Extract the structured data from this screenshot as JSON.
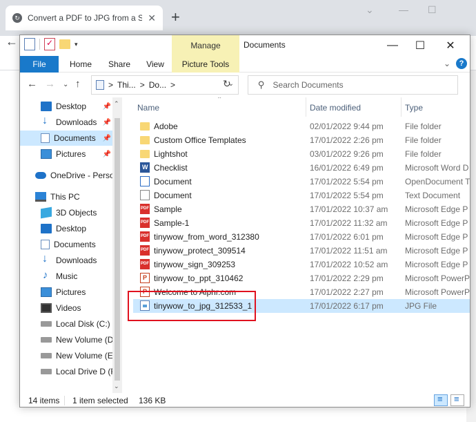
{
  "browser": {
    "tab_title": "Convert a PDF to JPG from a Sma",
    "tab_close": "✕",
    "new_tab": "+",
    "window_controls": [
      "⌄",
      "—",
      "☐"
    ]
  },
  "explorer": {
    "title": "Documents",
    "manage_label": "Manage",
    "ribbon_tabs": [
      "File",
      "Home",
      "Share",
      "View",
      "Picture Tools"
    ],
    "address_parts": [
      "Thi...",
      "Do..."
    ],
    "address_sep": ">",
    "search_placeholder": "Search Documents",
    "columns": {
      "name": "Name",
      "date": "Date modified",
      "type": "Type"
    },
    "quick_access": [
      {
        "label": "Desktop",
        "icon": "desktop-icon"
      },
      {
        "label": "Downloads",
        "icon": "downloads-icon"
      },
      {
        "label": "Documents",
        "icon": "documents-icon"
      },
      {
        "label": "Pictures",
        "icon": "pictures-icon"
      }
    ],
    "onedrive": "OneDrive - Person",
    "this_pc": "This PC",
    "pc_items": [
      {
        "label": "3D Objects",
        "icon": "3d-objects-icon"
      },
      {
        "label": "Desktop",
        "icon": "desktop-icon"
      },
      {
        "label": "Documents",
        "icon": "documents-icon"
      },
      {
        "label": "Downloads",
        "icon": "downloads-icon"
      },
      {
        "label": "Music",
        "icon": "music-icon"
      },
      {
        "label": "Pictures",
        "icon": "pictures-icon"
      },
      {
        "label": "Videos",
        "icon": "videos-icon"
      },
      {
        "label": "Local Disk (C:)",
        "icon": "drive-icon"
      },
      {
        "label": "New Volume (D:",
        "icon": "drive-icon"
      },
      {
        "label": "New Volume (E:)",
        "icon": "drive-icon"
      },
      {
        "label": "Local Drive D (F:",
        "icon": "drive-icon"
      }
    ],
    "files": [
      {
        "name": "Adobe",
        "date": "02/01/2022 9:44 pm",
        "type": "File folder",
        "icon": "folder"
      },
      {
        "name": "Custom Office Templates",
        "date": "17/01/2022 2:26 pm",
        "type": "File folder",
        "icon": "folder"
      },
      {
        "name": "Lightshot",
        "date": "03/01/2022 9:26 pm",
        "type": "File folder",
        "icon": "folder"
      },
      {
        "name": "Checklist",
        "date": "16/01/2022 6:49 pm",
        "type": "Microsoft Word D",
        "icon": "word"
      },
      {
        "name": "Document",
        "date": "17/01/2022 5:54 pm",
        "type": "OpenDocument T",
        "icon": "odt"
      },
      {
        "name": "Document",
        "date": "17/01/2022 5:54 pm",
        "type": "Text Document",
        "icon": "txt"
      },
      {
        "name": "Sample",
        "date": "17/01/2022 10:37 am",
        "type": "Microsoft Edge P",
        "icon": "pdf"
      },
      {
        "name": "Sample-1",
        "date": "17/01/2022 11:32 am",
        "type": "Microsoft Edge P",
        "icon": "pdf"
      },
      {
        "name": "tinywow_from_word_312380",
        "date": "17/01/2022 6:01 pm",
        "type": "Microsoft Edge P",
        "icon": "pdf"
      },
      {
        "name": "tinywow_protect_309514",
        "date": "17/01/2022 11:51 am",
        "type": "Microsoft Edge P",
        "icon": "pdf"
      },
      {
        "name": "tinywow_sign_309253",
        "date": "17/01/2022 10:52 am",
        "type": "Microsoft Edge P",
        "icon": "pdf"
      },
      {
        "name": "tinywow_to_ppt_310462",
        "date": "17/01/2022 2:29 pm",
        "type": "Microsoft PowerP",
        "icon": "ppt"
      },
      {
        "name": "Welcome to Alphr.com",
        "date": "17/01/2022 2:27 pm",
        "type": "Microsoft PowerP",
        "icon": "ppt"
      },
      {
        "name": "tinywow_to_jpg_312533_1",
        "date": "17/01/2022 6:17 pm",
        "type": "JPG File",
        "icon": "jpg",
        "selected": true
      }
    ],
    "status": {
      "count": "14 items",
      "selected": "1 item selected",
      "size": "136 KB"
    },
    "colors": {
      "file_tab": "#1979ca",
      "selection": "#cce8ff",
      "manage": "#f7f1b5",
      "highlight": "#e0111e"
    }
  }
}
